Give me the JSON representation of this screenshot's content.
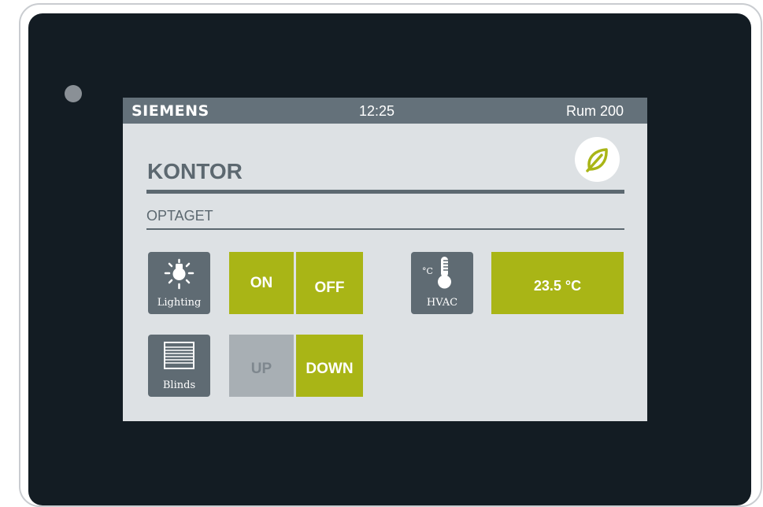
{
  "statusbar": {
    "brand": "SIEMENS",
    "time": "12:25",
    "room": "Rum 200"
  },
  "room": {
    "title": "KONTOR",
    "status": "OPTAGET"
  },
  "eco_mode": {
    "icon": "leaf-icon",
    "color": "#a9b516"
  },
  "controls": {
    "lighting": {
      "icon": "light-bulb-icon",
      "label": "Lighting",
      "on_label": "ON",
      "off_label": "OFF"
    },
    "hvac": {
      "icon": "thermometer-icon",
      "label": "HVAC",
      "unit_glyph": "°C",
      "value": "23.5 °C"
    },
    "blinds": {
      "icon": "blinds-icon",
      "label": "Blinds",
      "up_label": "UP",
      "down_label": "DOWN"
    }
  },
  "colors": {
    "accent": "#a9b516",
    "header": "#64717a",
    "screen_bg": "#dde1e4",
    "icon_tile": "#5f6b73",
    "disabled": "#a8afb4",
    "bezel": "#131c23"
  }
}
